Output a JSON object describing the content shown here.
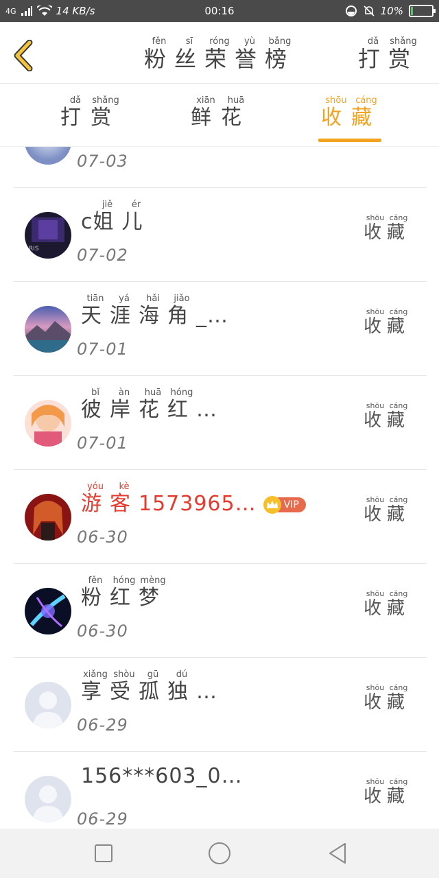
{
  "status_bar": {
    "network": "4G",
    "speed": "14 KB/s",
    "time": "00:16",
    "battery": "10%",
    "battery_level": 0.1
  },
  "header": {
    "title": [
      {
        "char": "粉",
        "pinyin": "fěn"
      },
      {
        "char": "丝",
        "pinyin": "sī"
      },
      {
        "char": "荣",
        "pinyin": "róng"
      },
      {
        "char": "誉",
        "pinyin": "yù"
      },
      {
        "char": "榜",
        "pinyin": "bǎng"
      }
    ],
    "reward": [
      {
        "char": "打",
        "pinyin": "dǎ"
      },
      {
        "char": "赏",
        "pinyin": "shǎng"
      }
    ]
  },
  "tabs": [
    {
      "chars": [
        {
          "char": "打",
          "pinyin": "dǎ"
        },
        {
          "char": "赏",
          "pinyin": "shǎng"
        }
      ],
      "active": false
    },
    {
      "chars": [
        {
          "char": "鲜",
          "pinyin": "xiān"
        },
        {
          "char": "花",
          "pinyin": "huā"
        }
      ],
      "active": false
    },
    {
      "chars": [
        {
          "char": "收",
          "pinyin": "shōu"
        },
        {
          "char": "藏",
          "pinyin": "cáng"
        }
      ],
      "active": true
    }
  ],
  "action_label": [
    {
      "char": "收",
      "pinyin": "shōu"
    },
    {
      "char": "藏",
      "pinyin": "cáng"
    }
  ],
  "list": [
    {
      "name": [],
      "date": "07-03",
      "avatar": "anime-avatar",
      "vip": false
    },
    {
      "name": [
        {
          "latin": "c"
        },
        {
          "char": "姐",
          "pinyin": "jiě"
        },
        {
          "char": "儿",
          "pinyin": "ér"
        }
      ],
      "date": "07-02",
      "avatar": "dark-avatar",
      "vip": false
    },
    {
      "name": [
        {
          "char": "天",
          "pinyin": "tiān"
        },
        {
          "char": "涯",
          "pinyin": "yá"
        },
        {
          "char": "海",
          "pinyin": "hǎi"
        },
        {
          "char": "角",
          "pinyin": "jiǎo"
        },
        {
          "latin": "_…"
        }
      ],
      "date": "07-01",
      "avatar": "landscape-avatar",
      "vip": false
    },
    {
      "name": [
        {
          "char": "彼",
          "pinyin": "bǐ"
        },
        {
          "char": "岸",
          "pinyin": "àn"
        },
        {
          "char": "花",
          "pinyin": "huā"
        },
        {
          "char": "红",
          "pinyin": "hóng"
        },
        {
          "latin": "…"
        }
      ],
      "date": "07-01",
      "avatar": "anime-girl-avatar",
      "vip": false
    },
    {
      "name": [
        {
          "char": "游",
          "pinyin": "yóu"
        },
        {
          "char": "客",
          "pinyin": "kè"
        },
        {
          "latin": "1573965…"
        }
      ],
      "date": "06-30",
      "avatar": "red-anime-avatar",
      "vip": true,
      "vip_label": "VIP",
      "highlight": true
    },
    {
      "name": [
        {
          "char": "粉",
          "pinyin": "fěn"
        },
        {
          "char": "红",
          "pinyin": "hóng"
        },
        {
          "char": "梦",
          "pinyin": "mèng"
        }
      ],
      "date": "06-30",
      "avatar": "blue-glow-avatar",
      "vip": false
    },
    {
      "name": [
        {
          "char": "享",
          "pinyin": "xiǎng"
        },
        {
          "char": "受",
          "pinyin": "shòu"
        },
        {
          "char": "孤",
          "pinyin": "gū"
        },
        {
          "char": "独",
          "pinyin": "dú"
        },
        {
          "latin": "…"
        }
      ],
      "date": "06-29",
      "avatar": "default-avatar",
      "vip": false
    },
    {
      "name": [
        {
          "latin": "156***603_0…"
        }
      ],
      "date": "06-29",
      "avatar": "default-avatar",
      "vip": false
    }
  ],
  "colors": {
    "accent": "#f3a21d",
    "vip_red": "#e33b2e",
    "divider": "#e6e6e6"
  }
}
